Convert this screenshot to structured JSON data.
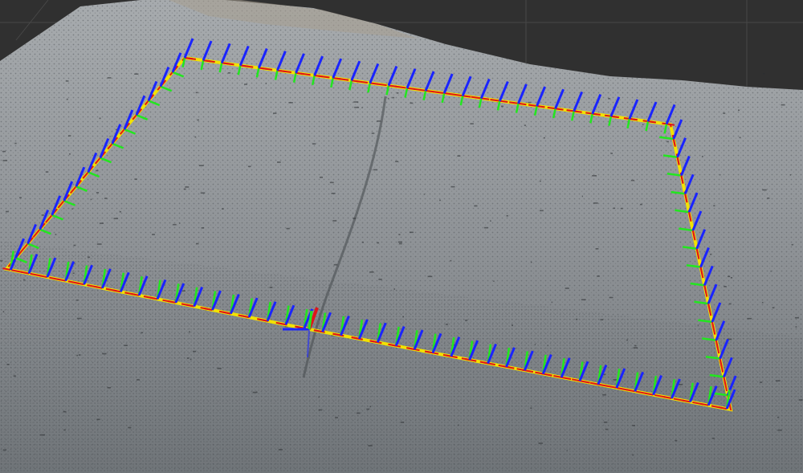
{
  "viewer": {
    "background_color": "#303030",
    "grid_line_color": "#474747",
    "pointcloud_top_color": "#9ea2a6",
    "pointcloud_bottom_color": "#6f7478",
    "pointcloud_texture_color": "#3c4044"
  },
  "trajectory": {
    "path_colors": [
      "#f2e200",
      "#e0141a"
    ],
    "axis_colors": {
      "x": "#e0141a",
      "y": "#22e61f",
      "z": "#1a24ff"
    },
    "pose_count": 96
  }
}
